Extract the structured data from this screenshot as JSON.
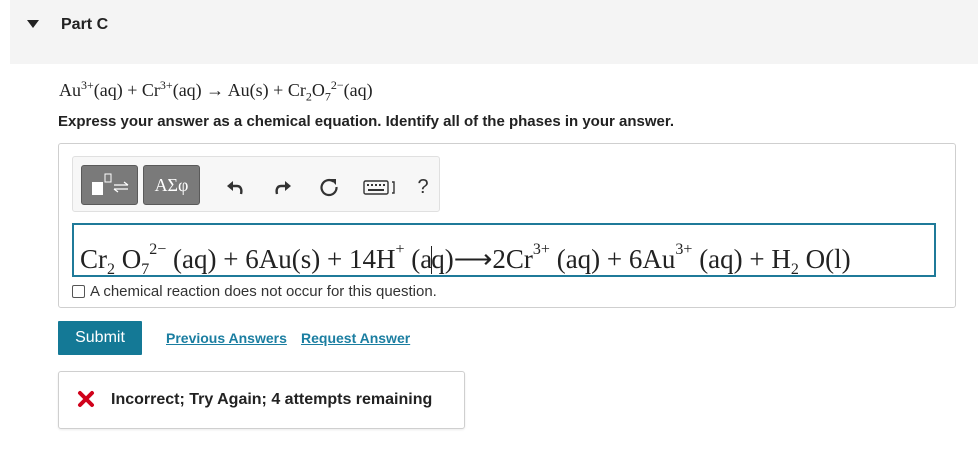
{
  "part": {
    "title": "Part C"
  },
  "problem": {
    "equation": [
      {
        "t": "Au"
      },
      {
        "sup": "3+"
      },
      {
        "t": "(aq) + Cr"
      },
      {
        "sup": "3+"
      },
      {
        "t": "(aq) → Au(s) + Cr"
      },
      {
        "sub": "2"
      },
      {
        "t": "O"
      },
      {
        "sub": "7"
      },
      {
        "sup": "2−"
      },
      {
        "t": "(aq)"
      }
    ],
    "instructions": "Express your answer as a chemical equation. Identify all of the phases in your answer."
  },
  "toolbar": {
    "symbols_label": "ΑΣφ",
    "icons": [
      "templates-icon",
      "symbols-icon",
      "undo-icon",
      "redo-icon",
      "reset-icon",
      "keyboard-icon",
      "help-icon"
    ],
    "help_label": "?"
  },
  "answer": {
    "equation": [
      {
        "t": "Cr"
      },
      {
        "sub": "2"
      },
      {
        "t": " O"
      },
      {
        "sub": "7"
      },
      {
        "sup": "2−"
      },
      {
        "t": " (aq) + 6Au(s) + 14H"
      },
      {
        "sup": "+"
      },
      {
        "t": " (a"
      },
      {
        "cursor": true
      },
      {
        "t": "q)⟶2Cr"
      },
      {
        "sup": "3+"
      },
      {
        "t": " (aq) + 6Au"
      },
      {
        "sup": "3+"
      },
      {
        "t": " (aq) + H"
      },
      {
        "sub": "2"
      },
      {
        "t": " O(l)"
      }
    ]
  },
  "no_reaction_label": "A chemical reaction does not occur for this question.",
  "actions": {
    "submit_label": "Submit",
    "previous_answers_label": "Previous Answers",
    "request_answer_label": "Request Answer"
  },
  "feedback": {
    "message": "Incorrect; Try Again; 4 attempts remaining",
    "status_color": "#d0021b"
  },
  "colors": {
    "accent": "#147996",
    "link": "#1b7ea1",
    "input_border": "#1f7a99"
  }
}
